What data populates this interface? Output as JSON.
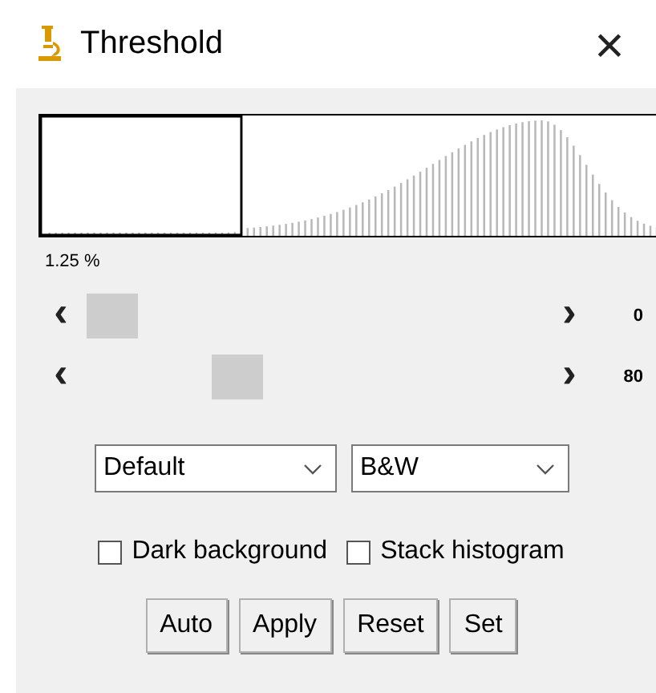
{
  "window": {
    "title": "Threshold",
    "close": "×"
  },
  "histogram": {
    "percent": "1.25 %"
  },
  "sliders": [
    {
      "left": "‹",
      "right": "›",
      "level": 0,
      "value": "0"
    },
    {
      "left": "‹",
      "right": "›",
      "level": 0.31,
      "value": "80"
    }
  ],
  "dropdowns": [
    {
      "value": "Default"
    },
    {
      "value": "B&W"
    }
  ],
  "checkboxes": [
    {
      "label": "Dark background",
      "checked": false
    },
    {
      "label": "Stack histogram",
      "checked": false
    }
  ],
  "buttons": [
    "Auto",
    "Apply",
    "Reset",
    "Set"
  ]
}
